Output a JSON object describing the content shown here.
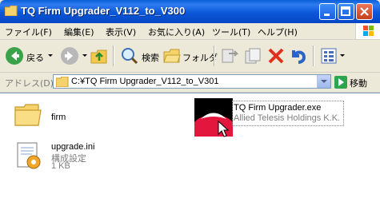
{
  "window": {
    "title": "TQ Firm Upgrader_V112_to_V300"
  },
  "menu": {
    "items": [
      "ファイル(F)",
      "編集(E)",
      "表示(V)",
      "お気に入り(A)",
      "ツール(T)",
      "ヘルプ(H)"
    ]
  },
  "toolbar": {
    "back_label": "戻る",
    "search_label": "検索",
    "folders_label": "フォルダ"
  },
  "address": {
    "label": "アドレス(D)",
    "path": "C:¥TQ Firm Upgrader_V112_to_V301",
    "go_label": "移動"
  },
  "files": [
    {
      "name": "firm",
      "type": "folder"
    },
    {
      "name": "TQ Firm Upgrader.exe",
      "sub": "Allied Telesis Holdings K.K.",
      "type": "exe"
    },
    {
      "name": "upgrade.ini",
      "sub": "構成設定",
      "size": "1 KB",
      "type": "ini"
    }
  ]
}
